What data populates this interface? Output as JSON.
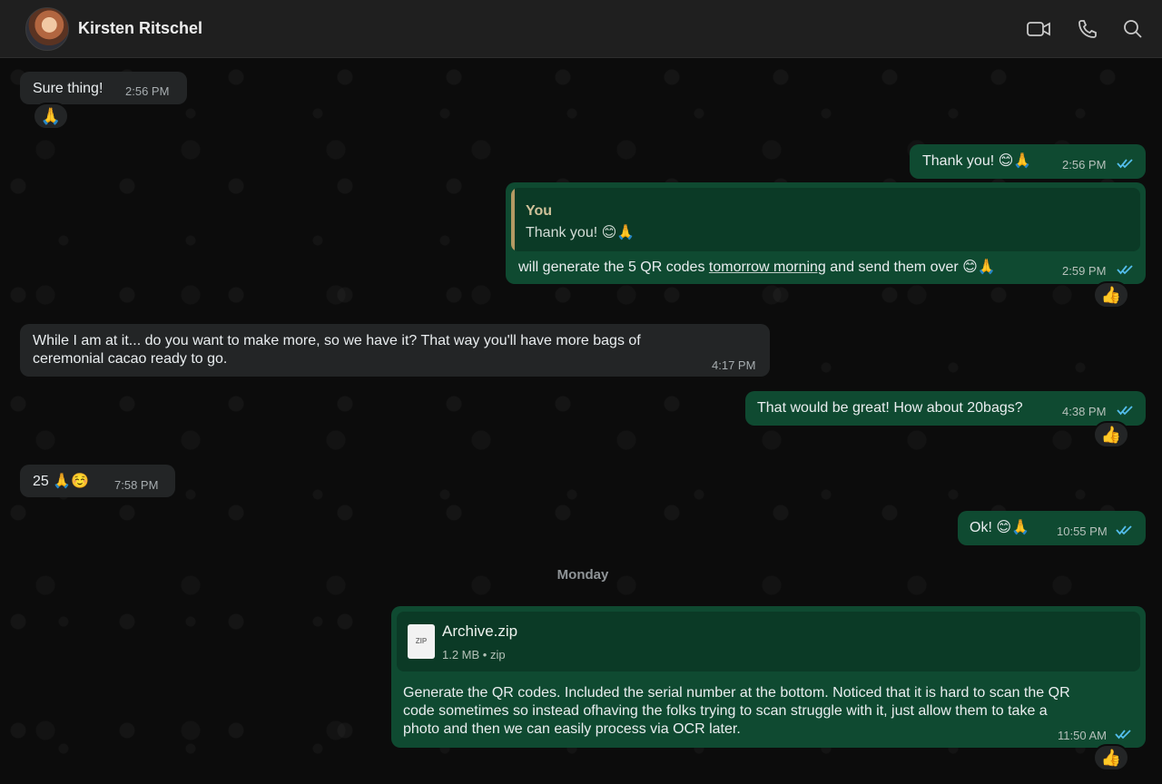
{
  "header": {
    "contact_name": "Kirsten Ritschel",
    "icons": [
      "video-call-icon",
      "voice-call-icon",
      "search-icon"
    ]
  },
  "messages": [
    {
      "direction": "incoming",
      "text": "Sure thing!",
      "time": "2:56 PM",
      "reaction": "🙏"
    },
    {
      "direction": "outgoing",
      "text": "Thank you! 😊🙏",
      "time": "2:56 PM",
      "status": "read"
    },
    {
      "direction": "outgoing",
      "quote": {
        "author": "You",
        "text": "Thank you! 😊🙏"
      },
      "text_before": "will generate the 5 QR codes ",
      "link_text": "tomorrow morning",
      "text_after": " and send them over 😊🙏",
      "time": "2:59 PM",
      "status": "read",
      "reaction": "👍"
    },
    {
      "direction": "incoming",
      "line1": "While I am at it... do you want to make more, so we have it? That way you'll have more bags of",
      "line2": "ceremonial cacao ready to go.",
      "time": "4:17 PM"
    },
    {
      "direction": "outgoing",
      "text": "That would be great! How about 20bags?",
      "time": "4:38 PM",
      "status": "read",
      "reaction": "👍"
    },
    {
      "direction": "incoming",
      "text": "25 🙏☺️",
      "time": "7:58 PM"
    },
    {
      "direction": "outgoing",
      "text": "Ok! 😊🙏",
      "time": "10:55 PM",
      "status": "read"
    },
    {
      "direction": "outgoing",
      "attachment": {
        "name": "Archive.zip",
        "meta": "1.2 MB • zip",
        "type_label": "ZIP"
      },
      "line1": "Generate the QR codes. Included the serial number at the bottom. Noticed that it is hard to scan the QR",
      "line2": "code sometimes so instead ofhaving the folks trying to scan struggle with it, just allow them to take a",
      "line3": "photo and then we can easily process via OCR later.",
      "time": "11:50 AM",
      "status": "read",
      "reaction": "👍"
    }
  ],
  "date_divider": "Monday",
  "colors": {
    "header_bg": "#1f1f1f",
    "chat_bg": "#0c0c0c",
    "incoming_bubble": "#232526",
    "outgoing_bubble": "#0f4a31",
    "read_ticks": "#53bdeb"
  }
}
